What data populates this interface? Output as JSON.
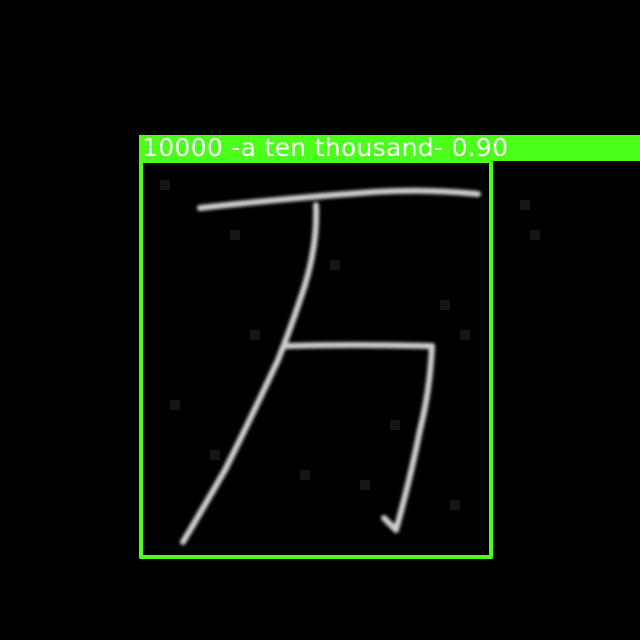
{
  "detection": {
    "label_text": "10000 -a ten thousand- 0.90",
    "box_color": "#4CFF1A",
    "label_text_color": "#FFFFFF"
  },
  "image": {
    "content": "handwritten character 万",
    "background_color": "#000000",
    "stroke_color": "#C8C8C8"
  }
}
